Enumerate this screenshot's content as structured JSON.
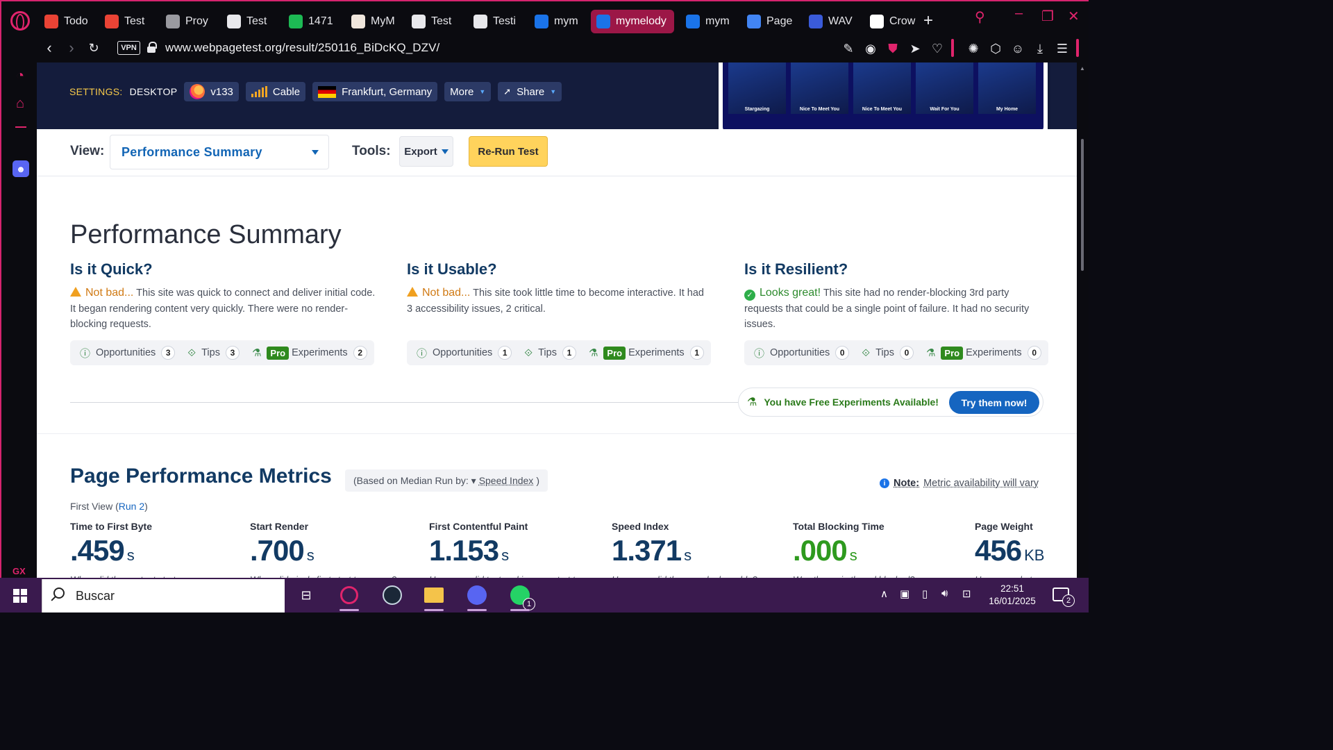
{
  "browser": {
    "tabs": [
      {
        "label": "Todo",
        "icon": "gmail-icon",
        "color": "#ea4335"
      },
      {
        "label": "Test",
        "icon": "gmail-icon",
        "color": "#ea4335"
      },
      {
        "label": "Proy",
        "icon": "openai-icon",
        "color": "#9a9aa0"
      },
      {
        "label": "Test",
        "icon": "webpagetest-icon",
        "color": "#e8e8ec"
      },
      {
        "label": "1471",
        "icon": "arch-icon",
        "color": "#1db954"
      },
      {
        "label": "MyM",
        "icon": "page-icon",
        "color": "#f0e6dc"
      },
      {
        "label": "Test",
        "icon": "webpagetest-icon",
        "color": "#e8e8ec"
      },
      {
        "label": "Testi",
        "icon": "openai-icon",
        "color": "#e8e8ec"
      },
      {
        "label": "mym",
        "icon": "site-icon",
        "color": "#1a73e8"
      },
      {
        "label": "mymelody",
        "icon": "site-icon",
        "color": "#1a73e8",
        "active": true
      },
      {
        "label": "mym",
        "icon": "site-icon",
        "color": "#1a73e8"
      },
      {
        "label": "Page",
        "icon": "pagespeed-icon",
        "color": "#4285f4"
      },
      {
        "label": "WAV",
        "icon": "wave-icon",
        "color": "#3a5bd9"
      },
      {
        "label": "Crow",
        "icon": "github-icon",
        "color": "#ffffff"
      }
    ],
    "vpn_label": "VPN",
    "url": "www.webpagetest.org/result/250116_BiDcKQ_DZV/"
  },
  "settings": {
    "label": "SETTINGS:",
    "device": "DESKTOP",
    "browser_version": "v133",
    "connection": "Cable",
    "location": "Frankfurt, Germany",
    "more_label": "More",
    "share_label": "Share"
  },
  "filmstrip": [
    "Stargazing",
    "Nice To Meet You",
    "Nice To Meet You",
    "Wait For You",
    "My Home"
  ],
  "viewbar": {
    "view_label": "View:",
    "view_value": "Performance Summary",
    "tools_label": "Tools:",
    "export_label": "Export",
    "rerun_label": "Re-Run Test"
  },
  "summary": {
    "title": "Performance Summary",
    "columns": [
      {
        "heading": "Is it Quick?",
        "verdict": "Not bad...",
        "verdict_type": "warn",
        "text": " This site was quick to connect and deliver initial code. It began rendering content very quickly. There were no render-blocking requests.",
        "opportunities_label": "Opportunities",
        "opportunities": "3",
        "tips_label": "Tips",
        "tips": "3",
        "pro_label": "Pro",
        "experiments_label": "Experiments",
        "experiments": "2"
      },
      {
        "heading": "Is it Usable?",
        "verdict": "Not bad...",
        "verdict_type": "warn",
        "text": " This site took little time to become interactive. It had 3 accessibility issues, 2 critical.",
        "opportunities_label": "Opportunities",
        "opportunities": "1",
        "tips_label": "Tips",
        "tips": "1",
        "pro_label": "Pro",
        "experiments_label": "Experiments",
        "experiments": "1"
      },
      {
        "heading": "Is it Resilient?",
        "verdict": "Looks great!",
        "verdict_type": "good",
        "text": " This site had no render-blocking 3rd party requests that could be a single point of failure. It had no security issues.",
        "opportunities_label": "Opportunities",
        "opportunities": "0",
        "tips_label": "Tips",
        "tips": "0",
        "pro_label": "Pro",
        "experiments_label": "Experiments",
        "experiments": "0"
      }
    ],
    "free_experiments_text": "You have Free Experiments Available!",
    "try_button": "Try them now!"
  },
  "metrics": {
    "title": "Page Performance Metrics",
    "median_prefix": "(Based on Median Run by: ▾",
    "median_metric": "Speed Index",
    "median_suffix": ")",
    "note_label": "Note:",
    "note_text": "Metric availability will vary",
    "first_view": "First View (",
    "run_link": "Run 2",
    "first_view_close": ")",
    "items": [
      {
        "label": "Time to First Byte",
        "value": ".459",
        "unit": "s",
        "desc": "When did the content start"
      },
      {
        "label": "Start Render",
        "value": ".700",
        "unit": "s",
        "desc": "When did pixels first start to appear?"
      },
      {
        "label": "First Contentful Paint",
        "value": "1.153",
        "unit": "s",
        "desc": "How soon did text and images start to appear?"
      },
      {
        "label": "Speed Index",
        "value": "1.371",
        "unit": "s",
        "desc": "How soon did the page look usable?"
      },
      {
        "label": "Total Blocking Time",
        "value": ".000",
        "unit": "s",
        "desc": "Was the main thread blocked?"
      },
      {
        "label": "Page Weight",
        "value": "456",
        "unit": "KB",
        "desc": "How many bytes"
      }
    ]
  },
  "taskbar": {
    "search_placeholder": "Buscar",
    "time": "22:51",
    "date": "16/01/2025",
    "whatsapp_badge": "1",
    "notifications": "2"
  },
  "colors": {
    "accent": "#e0246c",
    "hero_bg": "#141c3c",
    "link": "#1565c0",
    "heading": "#123a63",
    "rerun": "#ffd35c"
  }
}
